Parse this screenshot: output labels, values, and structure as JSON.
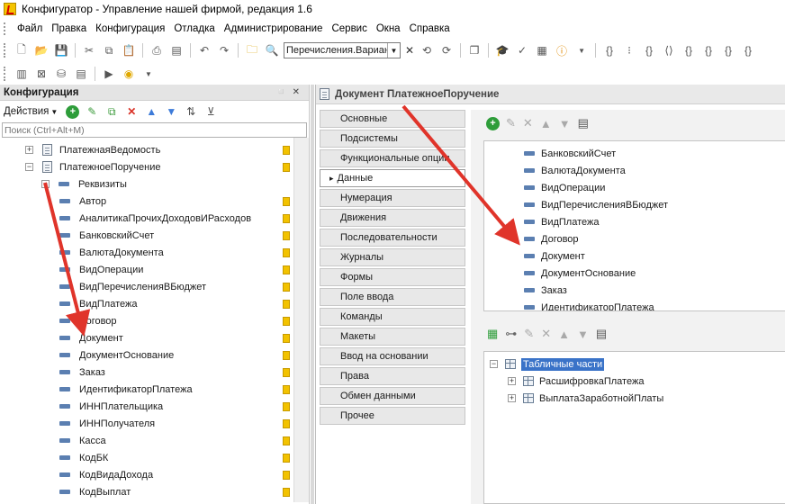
{
  "window": {
    "title": "Конфигуратор - Управление нашей фирмой, редакция 1.6"
  },
  "menu": [
    "Файл",
    "Правка",
    "Конфигурация",
    "Отладка",
    "Администрирование",
    "Сервис",
    "Окна",
    "Справка"
  ],
  "toolbar": {
    "search_value": "Перечисления.Вариан"
  },
  "left_panel": {
    "title": "Конфигурация",
    "actions_label": "Действия",
    "search_placeholder": "Поиск (Ctrl+Alt+M)",
    "tree": [
      {
        "label": "ПлатежнаяВедомость",
        "level": 0,
        "kind": "doc",
        "expander": "+"
      },
      {
        "label": "ПлатежноеПоручение",
        "level": 0,
        "kind": "doc",
        "expander": "−"
      },
      {
        "label": "Реквизиты",
        "level": 1,
        "kind": "attr",
        "expander": "−"
      },
      {
        "label": "Автор",
        "level": 2,
        "kind": "attr"
      },
      {
        "label": "АналитикаПрочихДоходовИРасходов",
        "level": 2,
        "kind": "attr"
      },
      {
        "label": "БанковскийСчет",
        "level": 2,
        "kind": "attr"
      },
      {
        "label": "ВалютаДокумента",
        "level": 2,
        "kind": "attr"
      },
      {
        "label": "ВидОперации",
        "level": 2,
        "kind": "attr"
      },
      {
        "label": "ВидПеречисленияВБюджет",
        "level": 2,
        "kind": "attr"
      },
      {
        "label": "ВидПлатежа",
        "level": 2,
        "kind": "attr"
      },
      {
        "label": "Договор",
        "level": 2,
        "kind": "attr"
      },
      {
        "label": "Документ",
        "level": 2,
        "kind": "attr"
      },
      {
        "label": "ДокументОснование",
        "level": 2,
        "kind": "attr"
      },
      {
        "label": "Заказ",
        "level": 2,
        "kind": "attr"
      },
      {
        "label": "ИдентификаторПлатежа",
        "level": 2,
        "kind": "attr"
      },
      {
        "label": "ИННПлательщика",
        "level": 2,
        "kind": "attr"
      },
      {
        "label": "ИННПолучателя",
        "level": 2,
        "kind": "attr"
      },
      {
        "label": "Касса",
        "level": 2,
        "kind": "attr"
      },
      {
        "label": "КодБК",
        "level": 2,
        "kind": "attr"
      },
      {
        "label": "КодВидаДохода",
        "level": 2,
        "kind": "attr"
      },
      {
        "label": "КодВыплат",
        "level": 2,
        "kind": "attr"
      }
    ]
  },
  "doc_window": {
    "title": "Документ ПлатежноеПоручение",
    "tabs": [
      "Основные",
      "Подсистемы",
      "Функциональные опции",
      "Данные",
      "Нумерация",
      "Движения",
      "Последовательности",
      "Журналы",
      "Формы",
      "Поле ввода",
      "Команды",
      "Макеты",
      "Ввод на основании",
      "Права",
      "Обмен данными",
      "Прочее"
    ],
    "active_tab": "Данные",
    "attributes": [
      "БанковскийСчет",
      "ВалютаДокумента",
      "ВидОперации",
      "ВидПеречисленияВБюджет",
      "ВидПлатежа",
      "Договор",
      "Документ",
      "ДокументОснование",
      "Заказ",
      "ИдентификаторПлатежа"
    ],
    "tabular_sections": {
      "root": "Табличные части",
      "items": [
        "РасшифровкаПлатежа",
        "ВыплатаЗаработнойПлаты"
      ]
    }
  },
  "colors": {
    "accent_arrow": "#e0342a",
    "selection": "#3a73c8",
    "add_green": "#2e9d3a",
    "delete_red": "#d93025",
    "up_down_blue": "#3d7bd9"
  }
}
